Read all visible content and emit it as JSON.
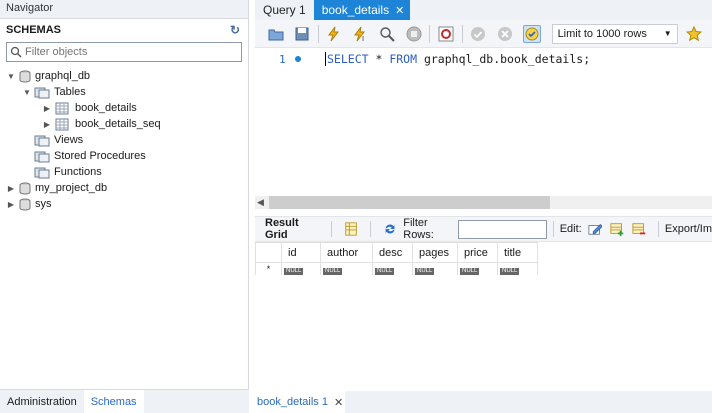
{
  "navigator": {
    "title": "Navigator",
    "schemas_label": "SCHEMAS",
    "filter_placeholder": "Filter objects",
    "tree": {
      "db1": "graphql_db",
      "tables": "Tables",
      "table1": "book_details",
      "table2": "book_details_seq",
      "views": "Views",
      "procs": "Stored Procedures",
      "funcs": "Functions",
      "db2": "my_project_db",
      "db3": "sys"
    },
    "tabs": [
      "Administration",
      "Schemas"
    ]
  },
  "editor": {
    "tabs": [
      "Query 1",
      "book_details"
    ],
    "limit": "Limit to 1000 rows",
    "line_number": "1",
    "sql_kw1": "SELECT",
    "sql_mid": " * ",
    "sql_kw2": "FROM",
    "sql_rest": " graphql_db.book_details;"
  },
  "results": {
    "result_grid": "Result Grid",
    "filter_rows": "Filter Rows:",
    "edit": "Edit:",
    "export": "Export/Im",
    "columns": [
      "id",
      "author",
      "desc",
      "pages",
      "price",
      "title"
    ],
    "null": "NULL",
    "new_row_marker": "*",
    "tab": "book_details 1"
  }
}
